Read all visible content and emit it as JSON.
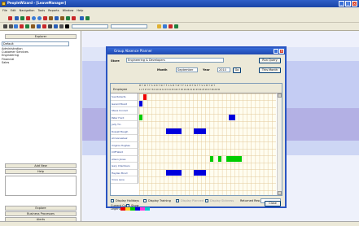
{
  "window": {
    "title": "PeopleWizard - [LeaveManager]"
  },
  "menu": [
    "File",
    "Edit",
    "Navigation",
    "Tools",
    "Reports",
    "Window",
    "Help"
  ],
  "toolbar": {
    "combo1_value": "",
    "combo2_value": ""
  },
  "left_panel": {
    "header": "Explorer",
    "combo_value": "Default",
    "departments": [
      "Administration",
      "Customer Services",
      "Engineering",
      "Financial",
      "Sales"
    ],
    "buttons": [
      "Add New",
      "Help",
      "Explore",
      "Business Processes",
      "Alerts"
    ]
  },
  "dialog": {
    "title": "Group Absence Planner",
    "store_label": "Store",
    "store_value": "Engineering & Developers",
    "run_query": "Run Query",
    "month_label": "Month",
    "month_value": "September",
    "year_label": "Year",
    "year_value": "2010",
    "go_label": "Go",
    "this_month": "This Month",
    "employee_label": "Employee",
    "weekdays": "M T W T F S S M T W T F S S M T W T F S S M T W T F S S M T W T",
    "days": "1 2 3 4 5 6 7 8 9 10 11 12 13 14 15 16 17 18 19 20 21 22 23 24 25 26 27 28 29 30",
    "employees": [
      "Sue Roberts",
      "Gerard Bould",
      "Steve Conrad",
      "Peter Hunt",
      "Judy Tin",
      "Russell Baugh",
      "Ali Gonsalvez",
      "Virginia Hughes",
      "Cliff Ward",
      "Alison Jones",
      "Gary Chambers",
      "Hayden Bond",
      "Vince Lane"
    ],
    "show_holiday_label": "Display Holidays",
    "show_training_label": "Display Training",
    "show_planned_label": "Display Planned",
    "show_sickness_label": "Display Sickness",
    "returned_label": "Returned Result",
    "returned_value": "",
    "current_code_label": "Current Code",
    "current_code_value": "Show",
    "legend_label": "Legend",
    "close_label": "Close",
    "colors": {
      "holiday": "#0000dd",
      "training": "#00cc00",
      "sick": "#ee0000",
      "grid": "#fffdf0"
    }
  }
}
